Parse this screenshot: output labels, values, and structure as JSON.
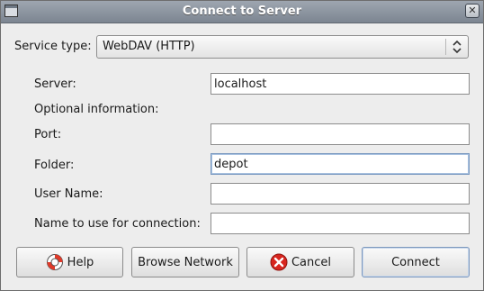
{
  "window": {
    "title": "Connect to Server"
  },
  "service": {
    "label": "Service type:",
    "value": "WebDAV (HTTP)"
  },
  "fields": {
    "server": {
      "label": "Server:",
      "value": "localhost"
    },
    "optional_heading": "Optional information:",
    "port": {
      "label": "Port:",
      "value": ""
    },
    "folder": {
      "label": "Folder:",
      "value": "depot"
    },
    "user": {
      "label": "User Name:",
      "value": ""
    },
    "conn_name": {
      "label": "Name to use for connection:",
      "value": ""
    }
  },
  "buttons": {
    "help": "Help",
    "browse": "Browse Network",
    "cancel": "Cancel",
    "connect": "Connect"
  },
  "icons": {
    "help": "lifebuoy-icon",
    "cancel": "cancel-icon",
    "combo": "up-down-arrows-icon",
    "close": "close-icon"
  },
  "colors": {
    "title_bar": "#8a939e",
    "cancel_red": "#d8261f",
    "lifebuoy_red": "#e03a2a"
  }
}
